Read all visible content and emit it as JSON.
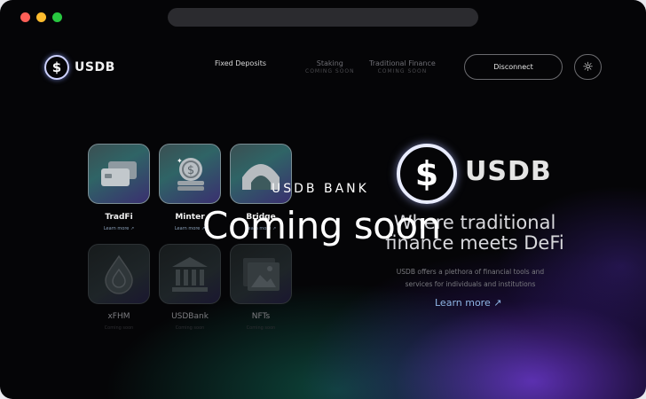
{
  "browser": {
    "dots": [
      {
        "name": "close-dot",
        "color": "#ff5f57"
      },
      {
        "name": "minimize-dot",
        "color": "#febc2e"
      },
      {
        "name": "maximize-dot",
        "color": "#28c840"
      }
    ]
  },
  "header": {
    "logo_text": "USDB",
    "logo_glyph": "$",
    "nav": {
      "fixed_deposits": "Fixed Deposits",
      "staking": "Staking",
      "staking_sub": "COMING SOON",
      "traditional_finance": "Traditional Finance",
      "traditional_finance_sub": "COMING SOON"
    },
    "disconnect_label": "Disconnect",
    "theme_icon": "sun-icon"
  },
  "tiles": [
    {
      "label": "TradFi",
      "sub": "Learn more ↗",
      "icon": "credit-cards-icon"
    },
    {
      "label": "Minter",
      "sub": "Learn more ↗",
      "icon": "coin-stack-icon"
    },
    {
      "label": "Bridge",
      "sub": "Learn more ↗",
      "icon": "bridge-icon"
    },
    {
      "label": "xFHM",
      "sub": "Coming soon",
      "icon": "drop-icon"
    },
    {
      "label": "USDBank",
      "sub": "Coming soon",
      "icon": "bank-icon"
    },
    {
      "label": "NFTs",
      "sub": "Coming soon",
      "icon": "image-icon"
    }
  ],
  "hero": {
    "logo_text": "USDB",
    "logo_glyph": "$",
    "title_line1": "Where traditional",
    "title_line2": "finance meets DeFi",
    "desc_line1": "USDB offers a plethora of financial tools and",
    "desc_line2": "services for individuals and institutions",
    "learn_more": "Learn more ↗"
  },
  "overlay": {
    "bank_label": "USDB BANK",
    "coming_soon": "Coming soon"
  },
  "colors": {
    "accent_blue": "#8fb6e6",
    "glow_purple": "#7a3fe0",
    "glow_teal": "#1a7a66"
  }
}
